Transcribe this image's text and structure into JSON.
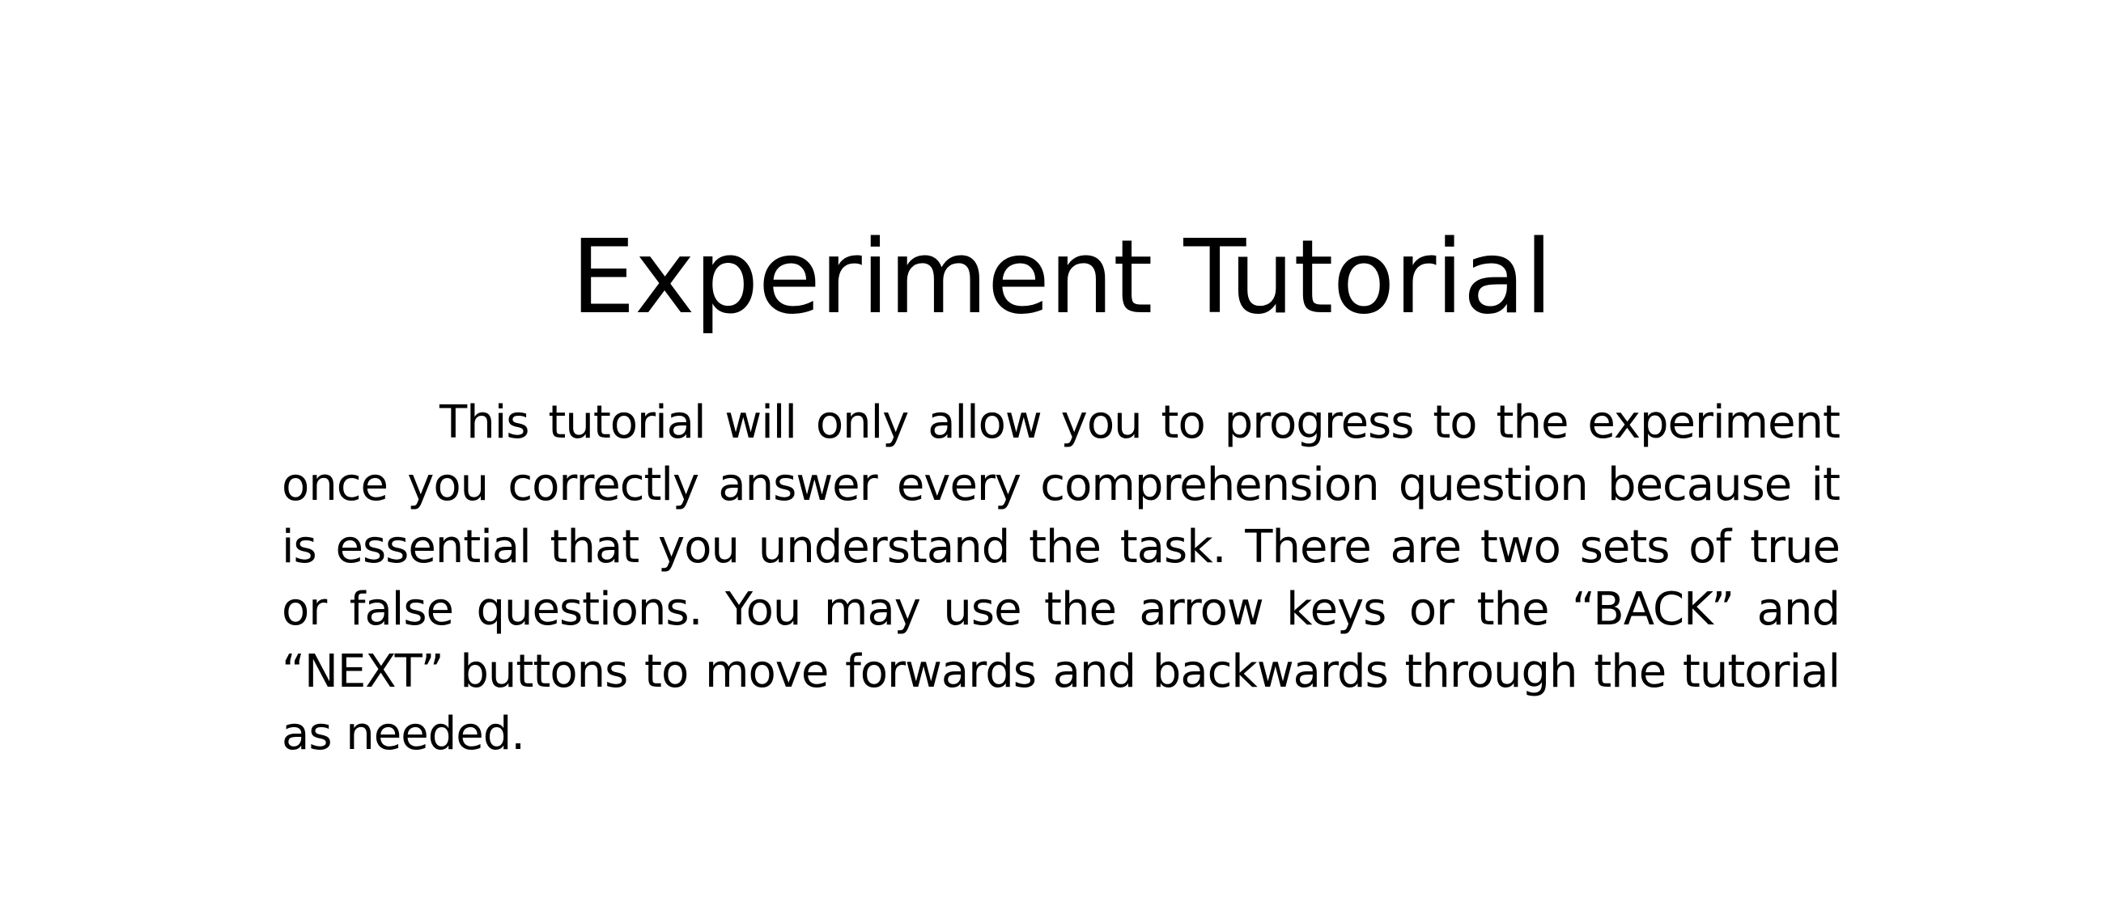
{
  "slide": {
    "title": "Experiment Tutorial",
    "body": "This tutorial will only allow you to progress to the experiment once you correctly answer every comprehension question because it is essential that you understand the task. There are two sets of true or false questions.  You may use the arrow keys or the “BACK” and “NEXT” buttons to move forwards and backwards through the tutorial as needed."
  }
}
